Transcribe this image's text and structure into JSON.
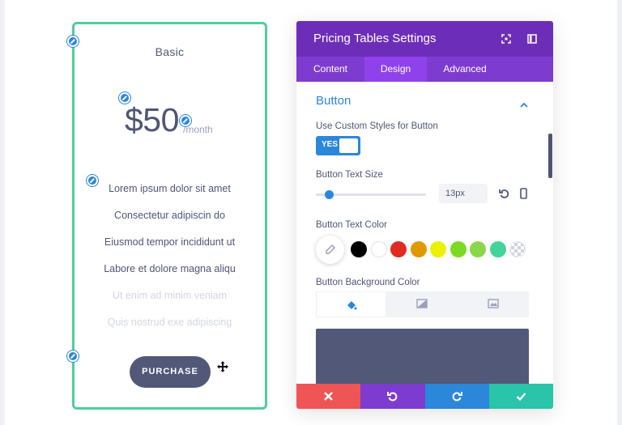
{
  "pricing": {
    "title": "Basic",
    "price": "$50",
    "per": "/month",
    "features": [
      {
        "text": "Lorem ipsum dolor sit amet",
        "enabled": true
      },
      {
        "text": "Consectetur adipiscin do",
        "enabled": true
      },
      {
        "text": "Eiusmod tempor incididunt ut",
        "enabled": true
      },
      {
        "text": "Labore et dolore magna aliqu",
        "enabled": true
      },
      {
        "text": "Ut enim ad minim veniam",
        "enabled": false
      },
      {
        "text": "Quis nostrud exe adipiscing",
        "enabled": false
      }
    ],
    "button_label": "PURCHASE"
  },
  "panel": {
    "title": "Pricing Tables Settings",
    "header_icons": [
      "expand-icon",
      "sidebar-icon"
    ],
    "tabs": [
      "Content",
      "Design",
      "Advanced"
    ],
    "active_tab": "Design",
    "section_title": "Button",
    "custom_styles_label": "Use Custom Styles for Button",
    "toggle_label": "YES",
    "toggle_on": true,
    "text_size_label": "Button Text Size",
    "text_size_value": "13px",
    "text_size_slider_fraction": 0.12,
    "text_color_label": "Button Text Color",
    "swatches": [
      "#000000",
      "#ffffff",
      "#e02b20",
      "#e09900",
      "#edf000",
      "#7cda24",
      "#8bd64a",
      "#42d49a",
      "transparent"
    ],
    "bg_color_label": "Button Background Color",
    "bg_tabs": [
      "color-fill-icon",
      "gradient-icon",
      "image-icon"
    ],
    "bg_color": "#525878",
    "actions": [
      {
        "name": "discard",
        "color": "#ef5555"
      },
      {
        "name": "undo",
        "color": "#7e3bd0"
      },
      {
        "name": "redo",
        "color": "#2b87da"
      },
      {
        "name": "save",
        "color": "#29c4a9"
      }
    ]
  },
  "colors": {
    "accent": "#2b87da",
    "card_border": "#4ecf9a",
    "header_purple": "#6c2eb9"
  }
}
